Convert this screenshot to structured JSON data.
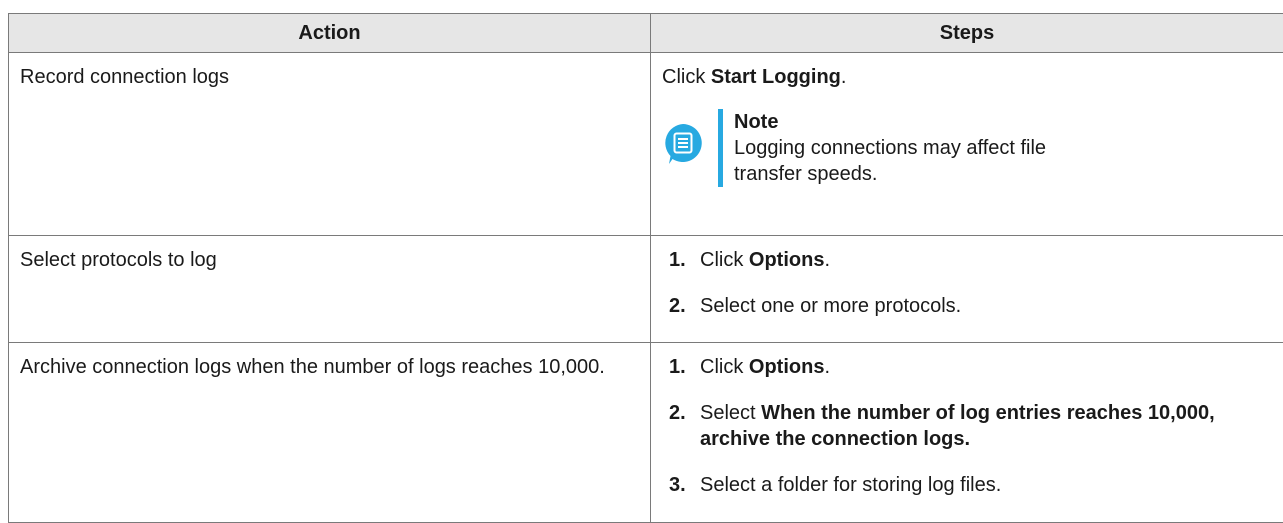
{
  "header": {
    "action": "Action",
    "steps": "Steps"
  },
  "rows": [
    {
      "action": "Record connection logs",
      "step_pre": "Click ",
      "step_bold": "Start Logging",
      "step_post": ".",
      "note_title": "Note",
      "note_text": "Logging connections may affect file transfer speeds."
    },
    {
      "action": "Select protocols to log",
      "steps": [
        {
          "num": "1.",
          "pre": "Click ",
          "bold": "Options",
          "post": "."
        },
        {
          "num": "2.",
          "pre": "Select one or more protocols.",
          "bold": "",
          "post": ""
        }
      ]
    },
    {
      "action": "Archive connection logs when the number of logs reaches 10,000.",
      "steps": [
        {
          "num": "1.",
          "pre": "Click ",
          "bold": "Options",
          "post": "."
        },
        {
          "num": "2.",
          "pre": "Select ",
          "bold": "When the number of log entries reaches 10,000, archive the connection logs.",
          "post": ""
        },
        {
          "num": "3.",
          "pre": "Select a folder for storing log files.",
          "bold": "",
          "post": ""
        }
      ]
    }
  ],
  "colors": {
    "note_accent": "#27a9e1",
    "header_bg": "#e6e6e6",
    "border": "#7a7a7a"
  },
  "icons": {
    "note": "note-icon"
  }
}
